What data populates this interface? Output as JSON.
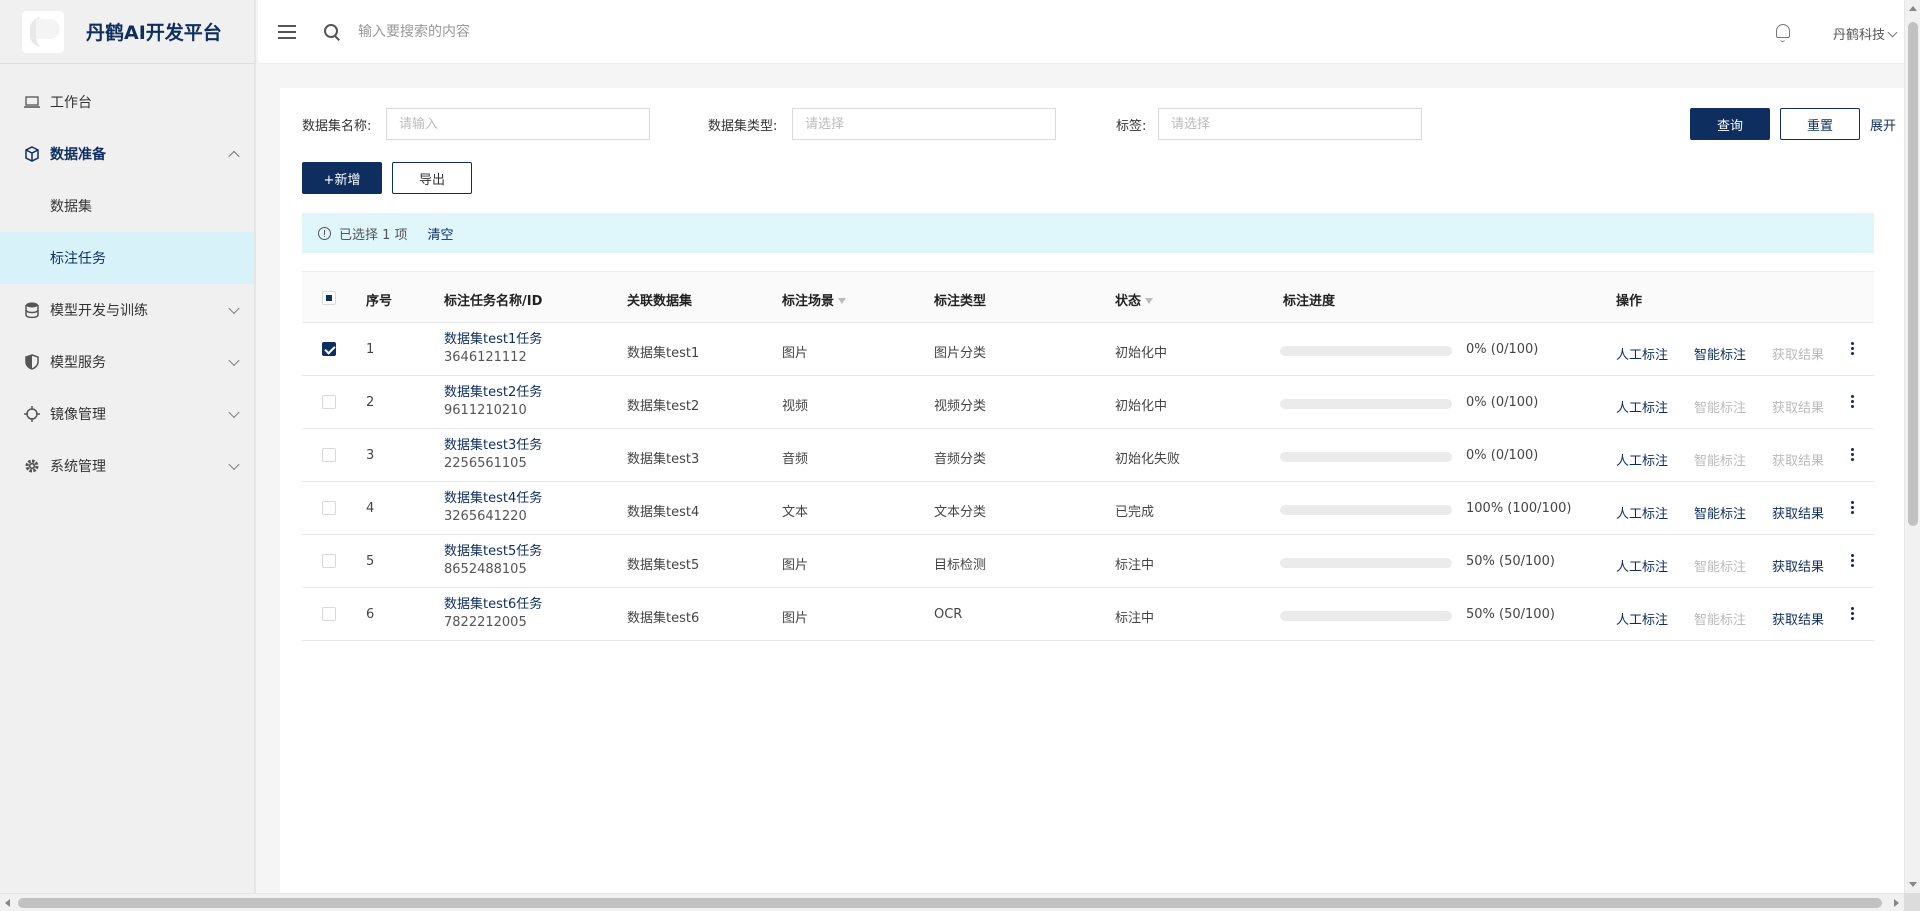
{
  "app": {
    "title": "丹鹤AI开发平台"
  },
  "sidebar": {
    "items": [
      {
        "label": "工作台",
        "icon": "laptop-icon"
      },
      {
        "label": "数据准备",
        "icon": "cube-icon",
        "expanded": true,
        "children": [
          {
            "label": "数据集",
            "active": false
          },
          {
            "label": "标注任务",
            "active": true
          }
        ]
      },
      {
        "label": "模型开发与训练",
        "icon": "database-icon",
        "expanded": false
      },
      {
        "label": "模型服务",
        "icon": "shield-icon",
        "expanded": false
      },
      {
        "label": "镜像管理",
        "icon": "crosshair-icon",
        "expanded": false
      },
      {
        "label": "系统管理",
        "icon": "gear-icon",
        "expanded": false
      }
    ]
  },
  "topbar": {
    "search_placeholder": "输入要搜索的内容",
    "user_name": "丹鹤科技"
  },
  "filters": {
    "name_label": "数据集名称:",
    "name_placeholder": "请输入",
    "type_label": "数据集类型:",
    "type_placeholder": "请选择",
    "tag_label": "标签:",
    "tag_placeholder": "请选择",
    "query_btn": "查询",
    "reset_btn": "重置",
    "expand_link": "展开"
  },
  "toolbar": {
    "add_btn": "+新增",
    "export_btn": "导出"
  },
  "selection": {
    "text": "已选择 1 项",
    "clear": "清空"
  },
  "table": {
    "headers": {
      "index": "序号",
      "name": "标注任务名称/ID",
      "dataset": "关联数据集",
      "scene": "标注场景",
      "type": "标注类型",
      "status": "状态",
      "progress": "标注进度",
      "ops": "操作"
    },
    "rows": [
      {
        "index": "1",
        "name": "数据集test1任务",
        "id": "3646121112",
        "dataset": "数据集test1",
        "scene": "图片",
        "type": "图片分类",
        "status": "初始化中",
        "progress": 0,
        "progress_text": "0% (0/100)",
        "checked": true,
        "ops": {
          "manual": "人工标注",
          "smart": "智能标注",
          "result": "获取结果",
          "smart_enabled": true,
          "result_enabled": false
        }
      },
      {
        "index": "2",
        "name": "数据集test2任务",
        "id": "9611210210",
        "dataset": "数据集test2",
        "scene": "视频",
        "type": "视频分类",
        "status": "初始化中",
        "progress": 0,
        "progress_text": "0% (0/100)",
        "checked": false,
        "ops": {
          "manual": "人工标注",
          "smart": "智能标注",
          "result": "获取结果",
          "smart_enabled": false,
          "result_enabled": false
        }
      },
      {
        "index": "3",
        "name": "数据集test3任务",
        "id": "2256561105",
        "dataset": "数据集test3",
        "scene": "音频",
        "type": "音频分类",
        "status": "初始化失败",
        "progress": 0,
        "progress_text": "0% (0/100)",
        "checked": false,
        "ops": {
          "manual": "人工标注",
          "smart": "智能标注",
          "result": "获取结果",
          "smart_enabled": false,
          "result_enabled": false
        }
      },
      {
        "index": "4",
        "name": "数据集test4任务",
        "id": "3265641220",
        "dataset": "数据集test4",
        "scene": "文本",
        "type": "文本分类",
        "status": "已完成",
        "progress": 100,
        "progress_text": "100% (100/100)",
        "checked": false,
        "ops": {
          "manual": "人工标注",
          "smart": "智能标注",
          "result": "获取结果",
          "smart_enabled": true,
          "result_enabled": true
        }
      },
      {
        "index": "5",
        "name": "数据集test5任务",
        "id": "8652488105",
        "dataset": "数据集test5",
        "scene": "图片",
        "type": "目标检测",
        "status": "标注中",
        "progress": 50,
        "progress_text": "50% (50/100)",
        "checked": false,
        "ops": {
          "manual": "人工标注",
          "smart": "智能标注",
          "result": "获取结果",
          "smart_enabled": false,
          "result_enabled": true
        }
      },
      {
        "index": "6",
        "name": "数据集test6任务",
        "id": "7822212005",
        "dataset": "数据集test6",
        "scene": "图片",
        "type": "OCR",
        "status": "标注中",
        "progress": 50,
        "progress_text": "50% (50/100)",
        "checked": false,
        "ops": {
          "manual": "人工标注",
          "smart": "智能标注",
          "result": "获取结果",
          "smart_enabled": false,
          "result_enabled": true
        }
      }
    ]
  },
  "colors": {
    "primary": "#0d2e5e",
    "selection_bg": "#dff6fb",
    "sidebar_active_bg": "#d8f2fa",
    "disabled": "#bbbbbb"
  }
}
